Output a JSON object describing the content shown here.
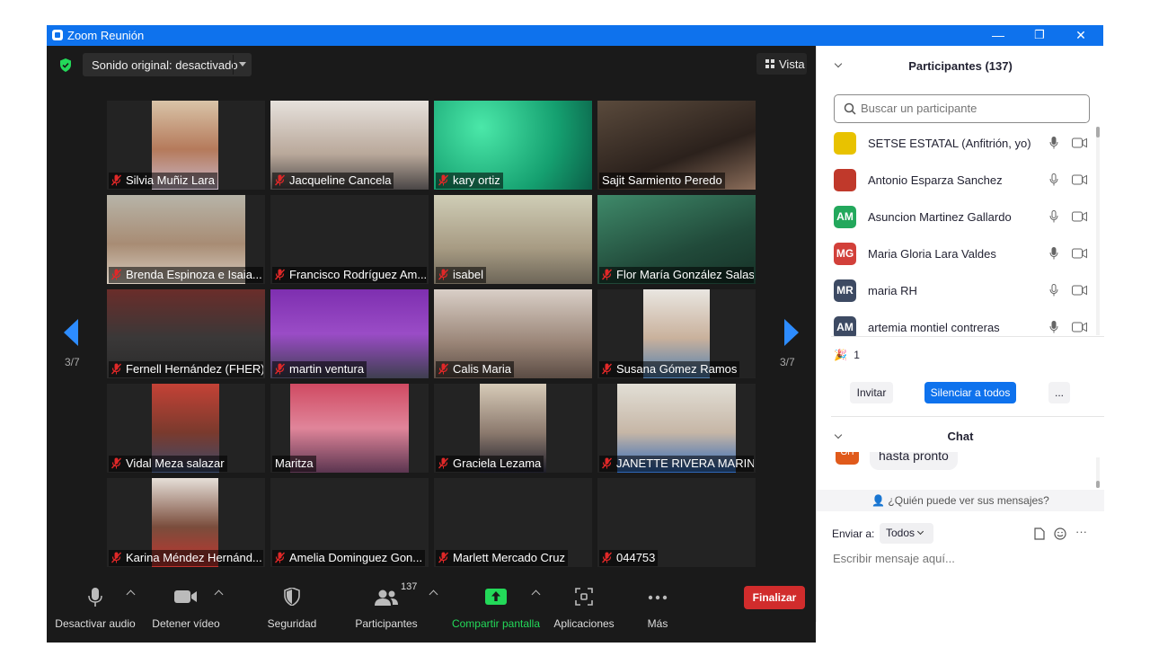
{
  "window": {
    "title": "Zoom Reunión",
    "minimize": "—",
    "restore": "❐",
    "close": "✕"
  },
  "topbar": {
    "sound_label": "Sonido original: desactivado",
    "view_label": "Vista"
  },
  "pager": {
    "left_page": "3/7",
    "right_page": "3/7"
  },
  "tiles": [
    {
      "name": "Silvia Muñiz Lara",
      "muted": true
    },
    {
      "name": "Jacqueline Cancela",
      "muted": true
    },
    {
      "name": "kary ortiz",
      "muted": true
    },
    {
      "name": "Sajit Sarmiento Peredo",
      "muted": false
    },
    {
      "name": "Brenda Espinoza e Isaia...",
      "muted": true
    },
    {
      "name": "Francisco Rodríguez Am...",
      "muted": true
    },
    {
      "name": "isabel",
      "muted": true
    },
    {
      "name": "Flor María González Salas",
      "muted": true
    },
    {
      "name": "Fernell Hernández (FHER)",
      "muted": true
    },
    {
      "name": "martin ventura",
      "muted": true
    },
    {
      "name": "Calis Maria",
      "muted": true
    },
    {
      "name": "Susana Gómez Ramos",
      "muted": true
    },
    {
      "name": "Vidal Meza salazar",
      "muted": true
    },
    {
      "name": "Maritza",
      "muted": false
    },
    {
      "name": "Graciela Lezama",
      "muted": true
    },
    {
      "name": "JANETTE RIVERA MARIN",
      "muted": true
    },
    {
      "name": "Karina Méndez Hernánd...",
      "muted": true
    },
    {
      "name": "Amelia Dominguez Gon...",
      "muted": true
    },
    {
      "name": "Marlett Mercado Cruz",
      "muted": true
    },
    {
      "name": "044753",
      "muted": true
    }
  ],
  "toolbar": {
    "audio": "Desactivar audio",
    "video": "Detener vídeo",
    "security": "Seguridad",
    "participants": "Participantes",
    "participants_count": "137",
    "share": "Compartir pantalla",
    "apps": "Aplicaciones",
    "more": "Más",
    "end": "Finalizar"
  },
  "panel": {
    "participants_header": "Participantes (137)",
    "search_placeholder": "Buscar un participante",
    "participants": [
      {
        "name": "SETSE ESTATAL (Anfitrión, yo)",
        "initials": "",
        "color": "#e8c200"
      },
      {
        "name": "Antonio Esparza Sanchez",
        "initials": "",
        "color": "#c0392b"
      },
      {
        "name": "Asuncion Martinez Gallardo",
        "initials": "AM",
        "color": "#23a85c"
      },
      {
        "name": "Maria Gloria Lara Valdes",
        "initials": "MG",
        "color": "#d2403a"
      },
      {
        "name": "maria RH",
        "initials": "MR",
        "color": "#3d4a63"
      },
      {
        "name": "artemia montiel contreras",
        "initials": "AM",
        "color": "#3d4a63"
      }
    ],
    "raise_hand_count": "1",
    "invite": "Invitar",
    "mute_all": "Silenciar a todos",
    "more": "...",
    "chat_header": "Chat",
    "chat_avatar": "OH",
    "chat_message": "hasta pronto",
    "who_can_see": "¿Quién puede ver sus mensajes?",
    "send_to_label": "Enviar a:",
    "send_to_value": "Todos",
    "chat_placeholder": "Escribir mensaje aquí...",
    "ellipsis": "···"
  }
}
